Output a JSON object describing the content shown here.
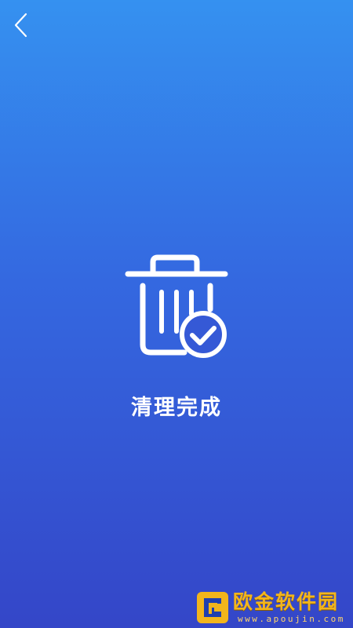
{
  "header": {
    "back_icon": "chevron-left-icon"
  },
  "result": {
    "icon": "trash-can-check-icon",
    "title": "清理完成"
  },
  "watermark": {
    "name": "欧金软件园",
    "url": "www.apoujin.com"
  },
  "colors": {
    "background_top": "#3591f0",
    "background_bottom": "#3446c8",
    "foreground": "#ffffff",
    "watermark": "#f2b51c"
  }
}
